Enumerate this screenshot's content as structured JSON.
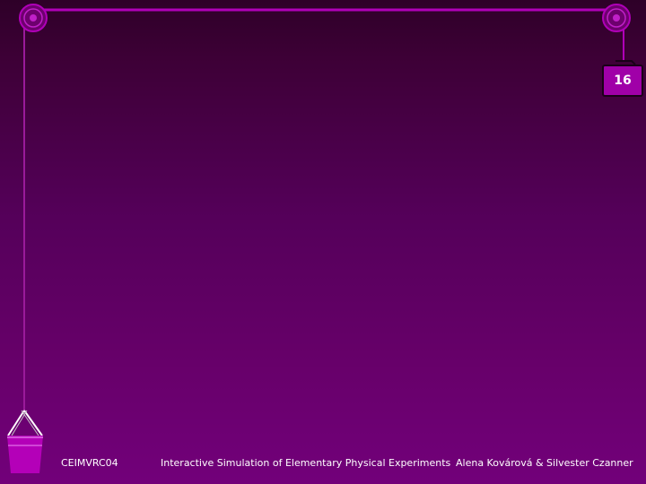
{
  "slide": {
    "page_number": "16",
    "footer_left": "CEIMVRC04",
    "footer_center": "Interactive Simulation of Elementary Physical Experiments",
    "footer_right": "Alena Kovárová & Silvester Czanner"
  },
  "colors": {
    "background_top": "#2e0028",
    "background_bottom": "#72007a",
    "rope": "#b000b8",
    "pulley": "#b000b8",
    "weight": "#a000a8",
    "bucket": "#b400b8"
  },
  "icons": [
    "pulley-left-icon",
    "pulley-right-icon",
    "weight-icon",
    "bucket-icon"
  ]
}
